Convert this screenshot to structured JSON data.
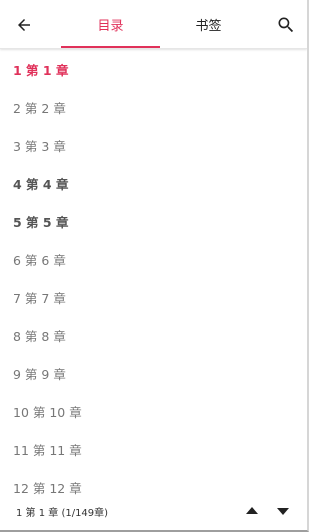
{
  "colors": {
    "accent": "#e0315a",
    "text_primary": "#222222",
    "text_bold": "#555555",
    "text_regular": "#777777"
  },
  "header": {
    "back_icon": "arrow-left-icon",
    "tabs": [
      {
        "label": "目录",
        "active": true
      },
      {
        "label": "书签",
        "active": false
      }
    ],
    "search_icon": "search-icon"
  },
  "chapters": [
    {
      "label": "1 第 1 章",
      "current": true,
      "bold": true
    },
    {
      "label": "2 第 2 章",
      "current": false,
      "bold": false
    },
    {
      "label": "3 第 3 章",
      "current": false,
      "bold": false
    },
    {
      "label": "4 第 4 章",
      "current": false,
      "bold": true
    },
    {
      "label": "5 第 5 章",
      "current": false,
      "bold": true
    },
    {
      "label": "6 第 6 章",
      "current": false,
      "bold": false
    },
    {
      "label": "7 第 7 章",
      "current": false,
      "bold": false
    },
    {
      "label": "8 第 8 章",
      "current": false,
      "bold": false
    },
    {
      "label": "9 第 9 章",
      "current": false,
      "bold": false
    },
    {
      "label": "10 第 10 章",
      "current": false,
      "bold": false
    },
    {
      "label": "11 第 11 章",
      "current": false,
      "bold": false
    },
    {
      "label": "12 第 12 章",
      "current": false,
      "bold": false
    }
  ],
  "footer": {
    "status": "1 第 1 章 (1/149章)",
    "up_icon": "triangle-up-icon",
    "down_icon": "triangle-down-icon"
  }
}
